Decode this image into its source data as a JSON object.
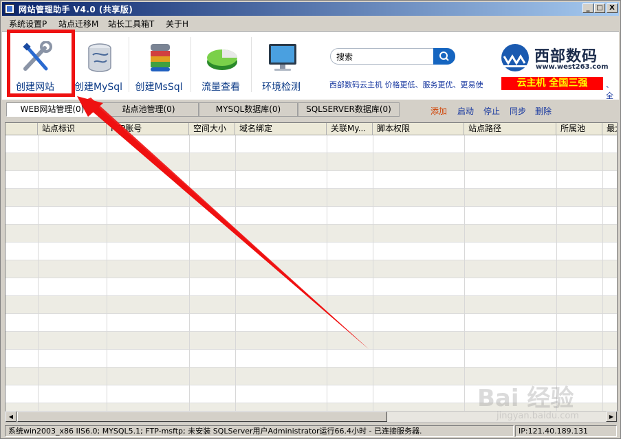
{
  "window": {
    "title": "网站管理助手 V4.0 (共享版)",
    "controls": [
      "_",
      "□",
      "X"
    ]
  },
  "menu": [
    {
      "label": "系统设置P"
    },
    {
      "label": "站点迁移M"
    },
    {
      "label": "站长工具箱T"
    },
    {
      "label": "关于H"
    }
  ],
  "toolbar": {
    "buttons": [
      {
        "label": "创建网站",
        "icon": "wrench-screwdriver-icon"
      },
      {
        "label": "创建MySql",
        "icon": "mysql-database-icon"
      },
      {
        "label": "创建MsSql",
        "icon": "mssql-database-icon"
      },
      {
        "label": "流量查看",
        "icon": "pie-chart-icon"
      },
      {
        "label": "环境检测",
        "icon": "monitor-icon"
      }
    ],
    "search_placeholder": "搜索",
    "brand_name": "西部数码",
    "brand_url": "www.west263.com",
    "ad_text": "西部数码云主机  价格更低、服务更优、更易使",
    "ad_banner": "云主机  全国三强",
    "ad_tail": "、全"
  },
  "tabs": [
    {
      "label": "WEB网站管理(0)",
      "active": true
    },
    {
      "label": "站点池管理(0)",
      "active": false
    },
    {
      "label": "MYSQL数据库(0)",
      "active": false
    },
    {
      "label": "SQLSERVER数据库(0)",
      "active": false
    }
  ],
  "actions": {
    "add": "添加",
    "start": "启动",
    "stop": "停止",
    "sync": "同步",
    "delete": "删除"
  },
  "grid": {
    "columns": [
      "",
      "站点标识",
      "FTP账号",
      "空间大小",
      "域名绑定",
      "关联My...",
      "脚本权限",
      "站点路径",
      "所属池",
      "最大"
    ],
    "row_count": 16
  },
  "status": {
    "main": "系统win2003_x86 IIS6.0; MYSQL5.1; FTP-msftp; 未安装 SQLServer用户Administrator运行66.4小时 - 已连接服务器.",
    "ip": "IP:121.40.189.131"
  },
  "watermark": {
    "text": "Bai 经验",
    "sub": "jingyan.baidu.com"
  },
  "colors": {
    "highlight": "#ee1111",
    "link_blue": "#1a3aa0",
    "ad_red": "#ff0000"
  }
}
